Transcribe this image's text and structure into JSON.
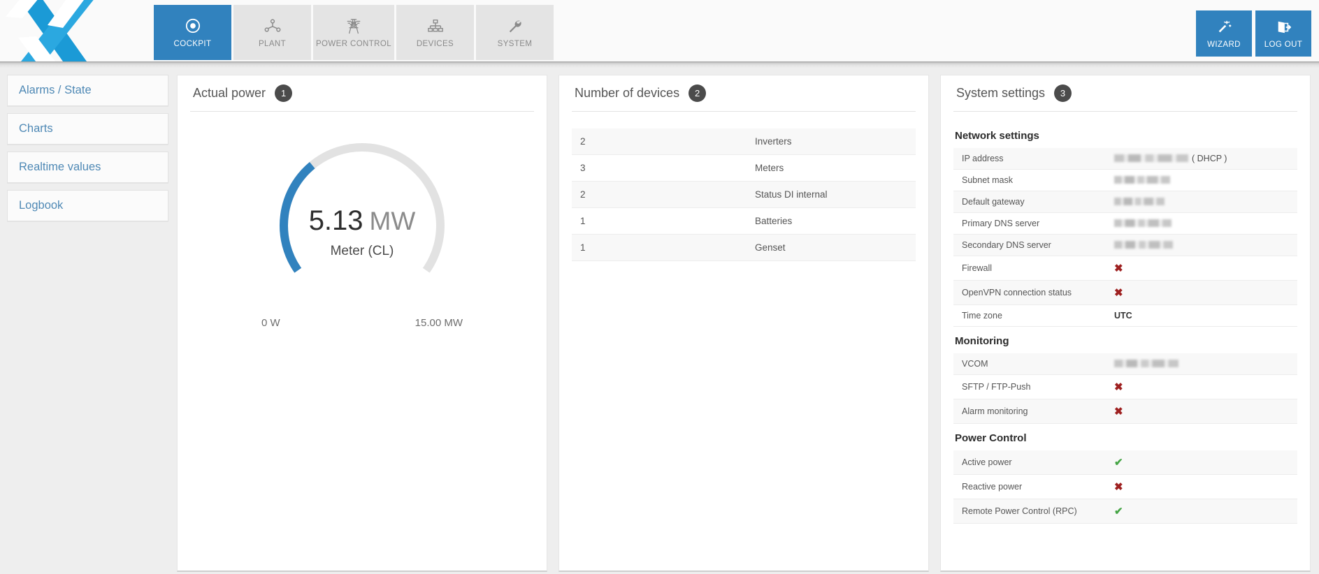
{
  "header": {
    "logo_name": "x-logo",
    "tabs": [
      {
        "label": "COCKPIT",
        "icon": "target-icon",
        "active": true
      },
      {
        "label": "PLANT",
        "icon": "plant-network-icon",
        "active": false
      },
      {
        "label": "POWER CONTROL",
        "icon": "power-pylon-icon",
        "active": false
      },
      {
        "label": "DEVICES",
        "icon": "devices-hierarchy-icon",
        "active": false
      },
      {
        "label": "SYSTEM",
        "icon": "wrench-icon",
        "active": false
      }
    ],
    "actions": [
      {
        "label": "WIZARD",
        "icon": "magic-wand-icon"
      },
      {
        "label": "LOG OUT",
        "icon": "logout-door-icon"
      }
    ],
    "accent_color": "#3182be"
  },
  "sidebar": {
    "items": [
      {
        "label": "Alarms / State"
      },
      {
        "label": "Charts"
      },
      {
        "label": "Realtime values"
      },
      {
        "label": "Logbook"
      }
    ]
  },
  "panels": {
    "actual_power": {
      "title": "Actual power",
      "badge": "1",
      "value": "5.13",
      "unit": "MW",
      "source": "Meter (CL)",
      "scale_min": "0 W",
      "scale_max": "15.00 MW"
    },
    "devices": {
      "title": "Number of devices",
      "badge": "2",
      "rows": [
        {
          "count": "2",
          "name": "Inverters"
        },
        {
          "count": "3",
          "name": "Meters"
        },
        {
          "count": "2",
          "name": "Status DI internal"
        },
        {
          "count": "1",
          "name": "Batteries"
        },
        {
          "count": "1",
          "name": "Genset"
        }
      ]
    },
    "system_settings": {
      "title": "System settings",
      "badge": "3",
      "groups": [
        {
          "title": "Network settings",
          "rows": [
            {
              "label": "IP address",
              "value_type": "masked",
              "suffix": "( DHCP )",
              "mask_width": 106
            },
            {
              "label": "Subnet mask",
              "value_type": "masked",
              "mask_width": 80
            },
            {
              "label": "Default gateway",
              "value_type": "masked",
              "mask_width": 72
            },
            {
              "label": "Primary DNS server",
              "value_type": "masked",
              "mask_width": 82
            },
            {
              "label": "Secondary DNS server",
              "value_type": "masked",
              "mask_width": 84
            },
            {
              "label": "Firewall",
              "value_type": "cross"
            },
            {
              "label": "OpenVPN connection status",
              "value_type": "cross"
            },
            {
              "label": "Time zone",
              "value_type": "text",
              "value": "UTC"
            }
          ]
        },
        {
          "title": "Monitoring",
          "rows": [
            {
              "label": "VCOM",
              "value_type": "masked",
              "mask_width": 92
            },
            {
              "label": "SFTP / FTP-Push",
              "value_type": "cross"
            },
            {
              "label": "Alarm monitoring",
              "value_type": "cross"
            }
          ]
        },
        {
          "title": "Power Control",
          "rows": [
            {
              "label": "Active power",
              "value_type": "check"
            },
            {
              "label": "Reactive power",
              "value_type": "cross"
            },
            {
              "label": "Remote Power Control (RPC)",
              "value_type": "check"
            }
          ]
        }
      ]
    }
  },
  "chart_data": {
    "type": "gauge",
    "title": "Actual power",
    "value": 5.13,
    "unit": "MW",
    "label": "Meter (CL)",
    "min": 0,
    "max": 15.0,
    "min_label": "0 W",
    "max_label": "15.00 MW",
    "percent": 34.2,
    "arc_start_deg": -125,
    "arc_end_deg": 125,
    "value_color": "#3182be",
    "track_color": "#e2e2e2"
  }
}
